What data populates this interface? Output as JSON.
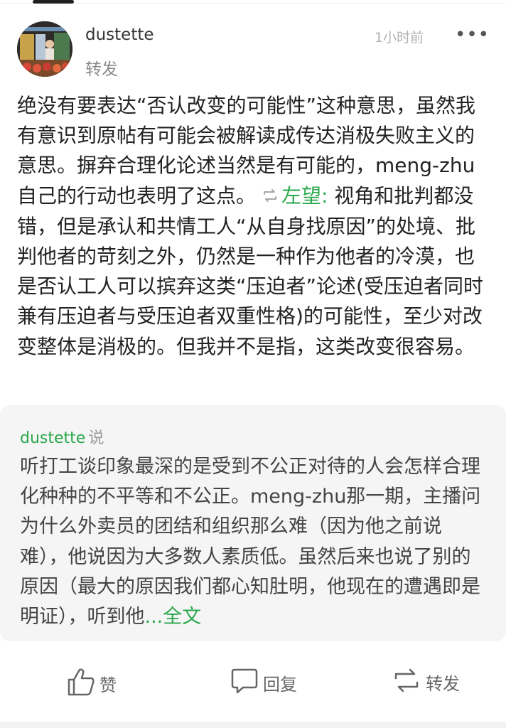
{
  "post": {
    "username": "dustette",
    "subtitle": "转发",
    "time": "1小时前",
    "more_label": "•••",
    "body_part1": "绝没有要表达“否认改变的可能性”这种意思，虽然我有意识到原帖有可能会被解读成传达消极失败主义的意思。摒弃合理化论述当然是有可能的，meng-zhu自己的行动也表明了这点。",
    "repost_user": "左望:",
    "body_part2": " 视角和批判都没错，但是承认和共情工人“从自身找原因”的处境、批判他者的苛刻之外，仍然是一种作为他者的冷漠，也是否认工人可以摈弃这类“压迫者”论述(受压迫者同时兼有压迫者与受压迫者双重性格)的可能性，至少对改变整体是消极的。但我并不是指，这类改变很容易。"
  },
  "quote": {
    "user": "dustette",
    "say": "说",
    "text": "听打工谈印象最深的是受到不公正对待的人会怎样合理化种种的不平等和不公正。meng-zhu那一期，主播问为什么外卖员的团结和组织那么难（因为他之前说难），他说因为大多数人素质低。虽然后来也说了别的原因（最大的原因我们都心知肚明，他现在的遭遇即是明证），听到他",
    "fulltext_label": "...全文"
  },
  "actions": {
    "like": "赞",
    "reply": "回复",
    "repost": "转发"
  },
  "icons": {
    "like": "thumbs-up-icon",
    "reply": "speech-bubble-icon",
    "repost": "repost-icon"
  },
  "colors": {
    "accent_green": "#2aa84b"
  }
}
